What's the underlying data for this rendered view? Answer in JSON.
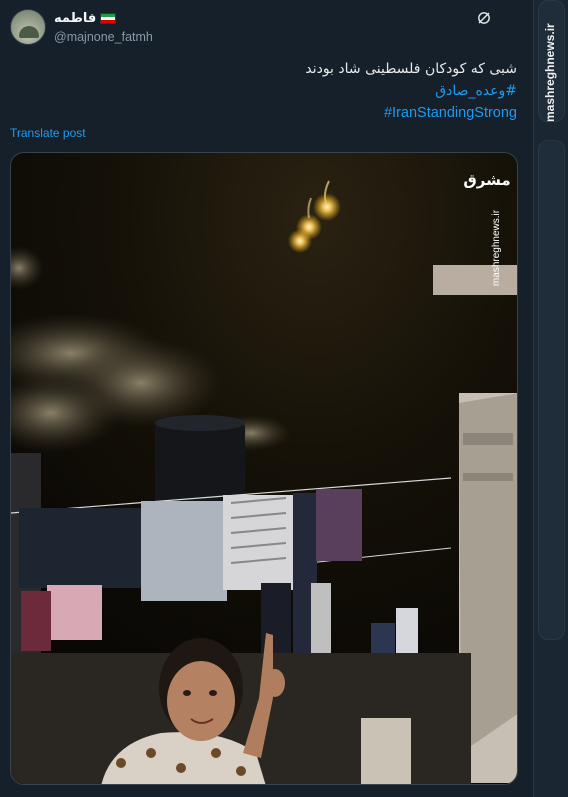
{
  "tweet": {
    "author": {
      "display_name": "فاطمه",
      "handle": "@majnone_fatmh",
      "flag": "iran-flag-icon"
    },
    "text_lines": [
      "شبی که کودکان فلسطینی شاد بودند"
    ],
    "hashtags": [
      "#وعده_صادق",
      "#IranStandingStrong"
    ],
    "translate_label": "Translate post",
    "media": {
      "watermark_logo": "مشرق",
      "watermark_url": "mashreghnews.ir"
    }
  },
  "sidebar": {
    "site_label": "mashreghnews.ir"
  },
  "colors": {
    "background": "#15202b",
    "link": "#1d9bf0",
    "muted": "#8b98a5"
  }
}
